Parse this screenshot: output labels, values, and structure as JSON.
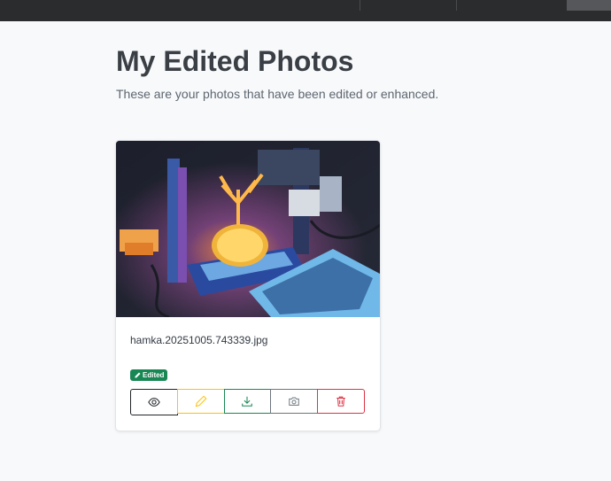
{
  "page": {
    "title": "My Edited Photos",
    "subtitle": "These are your photos that have been edited or enhanced."
  },
  "photos": [
    {
      "filename": "hamka.20251005.743339.jpg",
      "badge": "Edited",
      "image_description_icon": "3d-printer-photo",
      "actions": [
        {
          "name": "view",
          "icon": "eye-icon",
          "color": "#212529"
        },
        {
          "name": "edit",
          "icon": "pencil-icon",
          "color": "#ffc107"
        },
        {
          "name": "download",
          "icon": "download-icon",
          "color": "#198754"
        },
        {
          "name": "camera",
          "icon": "camera-icon",
          "color": "#6c757d"
        },
        {
          "name": "delete",
          "icon": "trash-icon",
          "color": "#dc3545"
        }
      ]
    }
  ],
  "colors": {
    "badge": "#198754",
    "topbar": "#2b2c2e",
    "background": "#f8f9fb"
  }
}
